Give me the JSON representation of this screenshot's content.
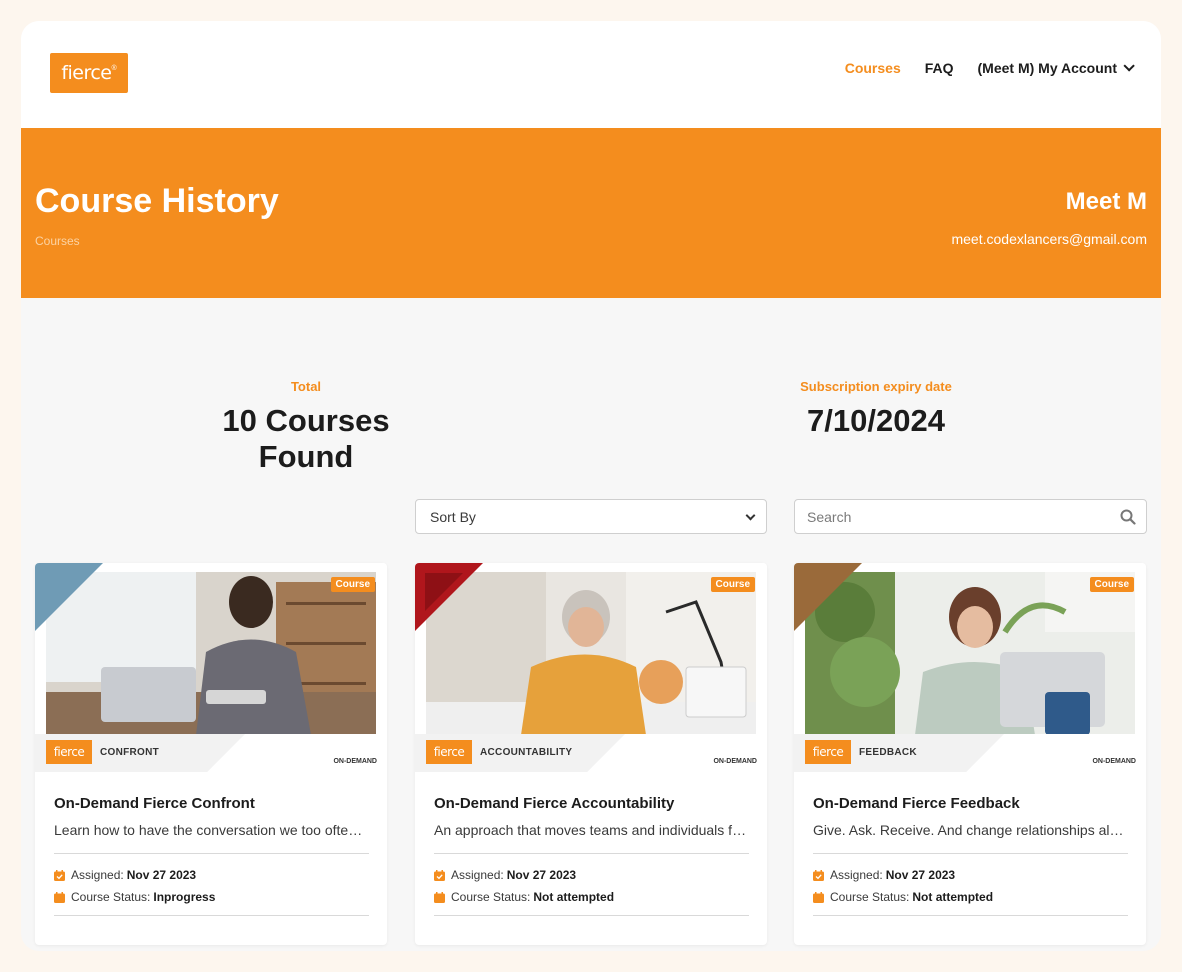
{
  "logo_text": "fierce",
  "nav": {
    "courses": "Courses",
    "faq": "FAQ",
    "account": "(Meet M) My Account"
  },
  "banner": {
    "title": "Course History",
    "breadcrumb": "Courses",
    "user_name": "Meet M",
    "user_email": "meet.codexlancers@gmail.com"
  },
  "stats": {
    "total_label": "Total",
    "total_value": "10 Courses Found",
    "expiry_label": "Subscription expiry date",
    "expiry_value": "7/10/2024"
  },
  "controls": {
    "sort_value": "Sort By",
    "search_placeholder": "Search"
  },
  "colors": {
    "accent": "#f48d1e",
    "corner_confront": "#6f9bb5",
    "corner_accountability": "#b0161c",
    "corner_feedback": "#9a6a3a"
  },
  "cards": [
    {
      "badge": "Course",
      "logo": "fierce",
      "brand": "CONFRONT",
      "tag": "ON-DEMAND",
      "title": "On-Demand Fierce Confront",
      "desc": "Learn how to have the conversation we too often avoid",
      "assigned_label": "Assigned:",
      "assigned": "Nov 27 2023",
      "status_label": "Course Status:",
      "status": "Inprogress"
    },
    {
      "badge": "Course",
      "logo": "fierce",
      "brand": "ACCOUNTABILITY",
      "tag": "ON-DEMAND",
      "title": "On-Demand Fierce Accountability",
      "desc": "An approach that moves teams and individuals from victim to accountable",
      "assigned_label": "Assigned:",
      "assigned": "Nov 27 2023",
      "status_label": "Course Status:",
      "status": "Not attempted"
    },
    {
      "badge": "Course",
      "logo": "fierce",
      "brand": "FEEDBACK",
      "tag": "ON-DEMAND",
      "title": "On-Demand Fierce Feedback",
      "desc": "Give. Ask. Receive. And change relationships along the way",
      "assigned_label": "Assigned:",
      "assigned": "Nov 27 2023",
      "status_label": "Course Status:",
      "status": "Not attempted"
    }
  ]
}
